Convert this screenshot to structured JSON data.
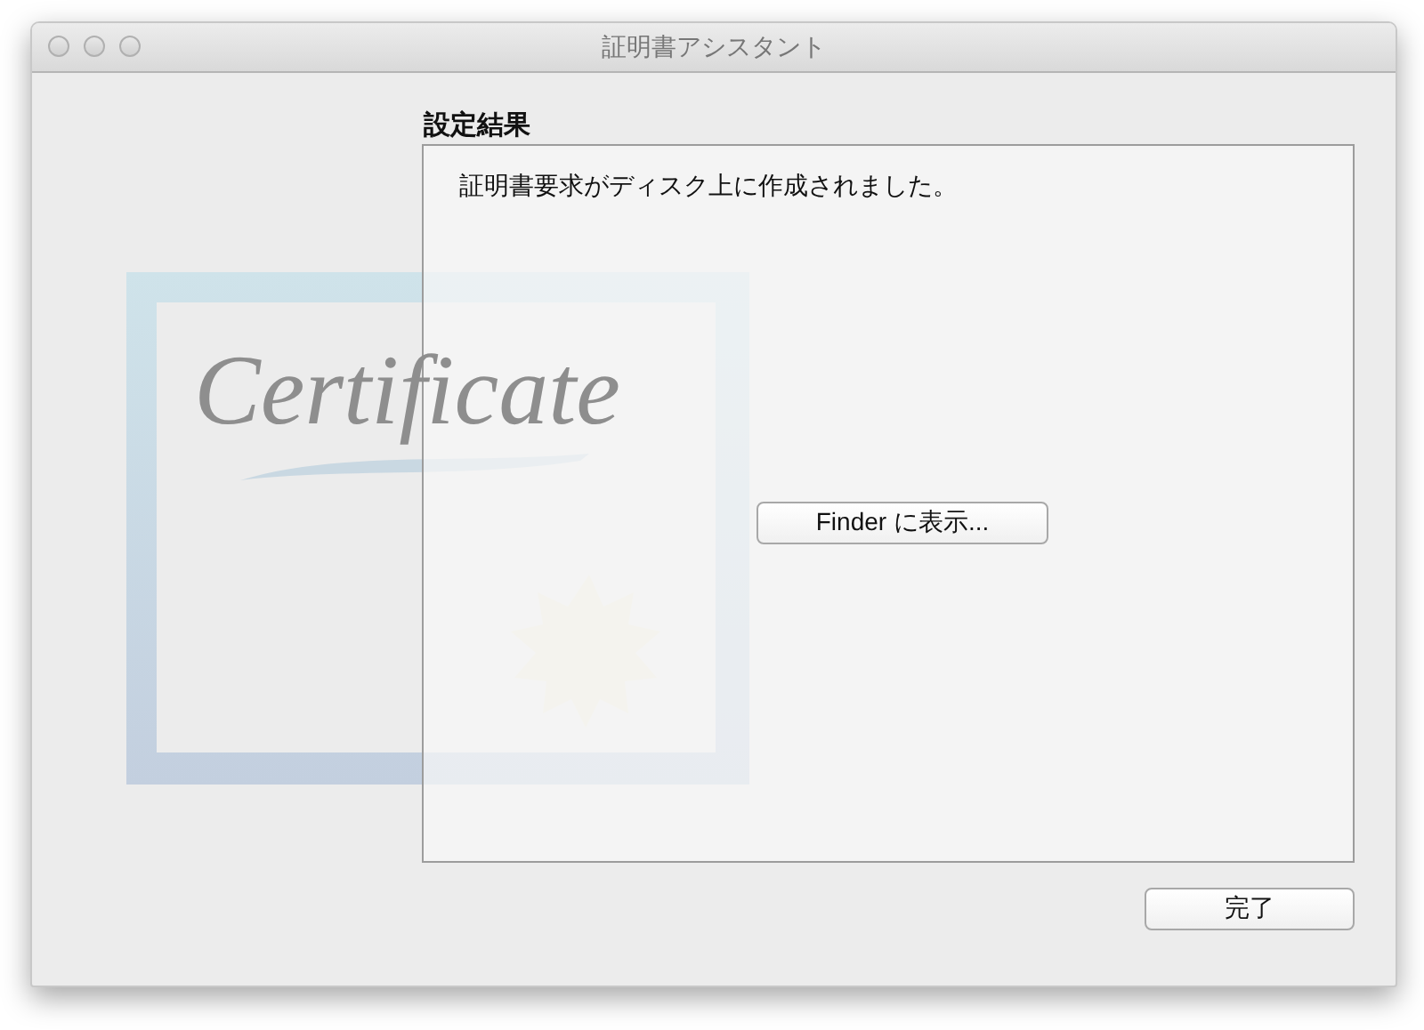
{
  "window": {
    "title": "証明書アシスタント"
  },
  "artwork": {
    "text": "Certificate"
  },
  "section_title": "設定結果",
  "message": "証明書要求がディスク上に作成されました。",
  "buttons": [
    {
      "kind": "center",
      "label": "Finder に表示..."
    },
    {
      "kind": "footer",
      "label": "完了"
    }
  ]
}
